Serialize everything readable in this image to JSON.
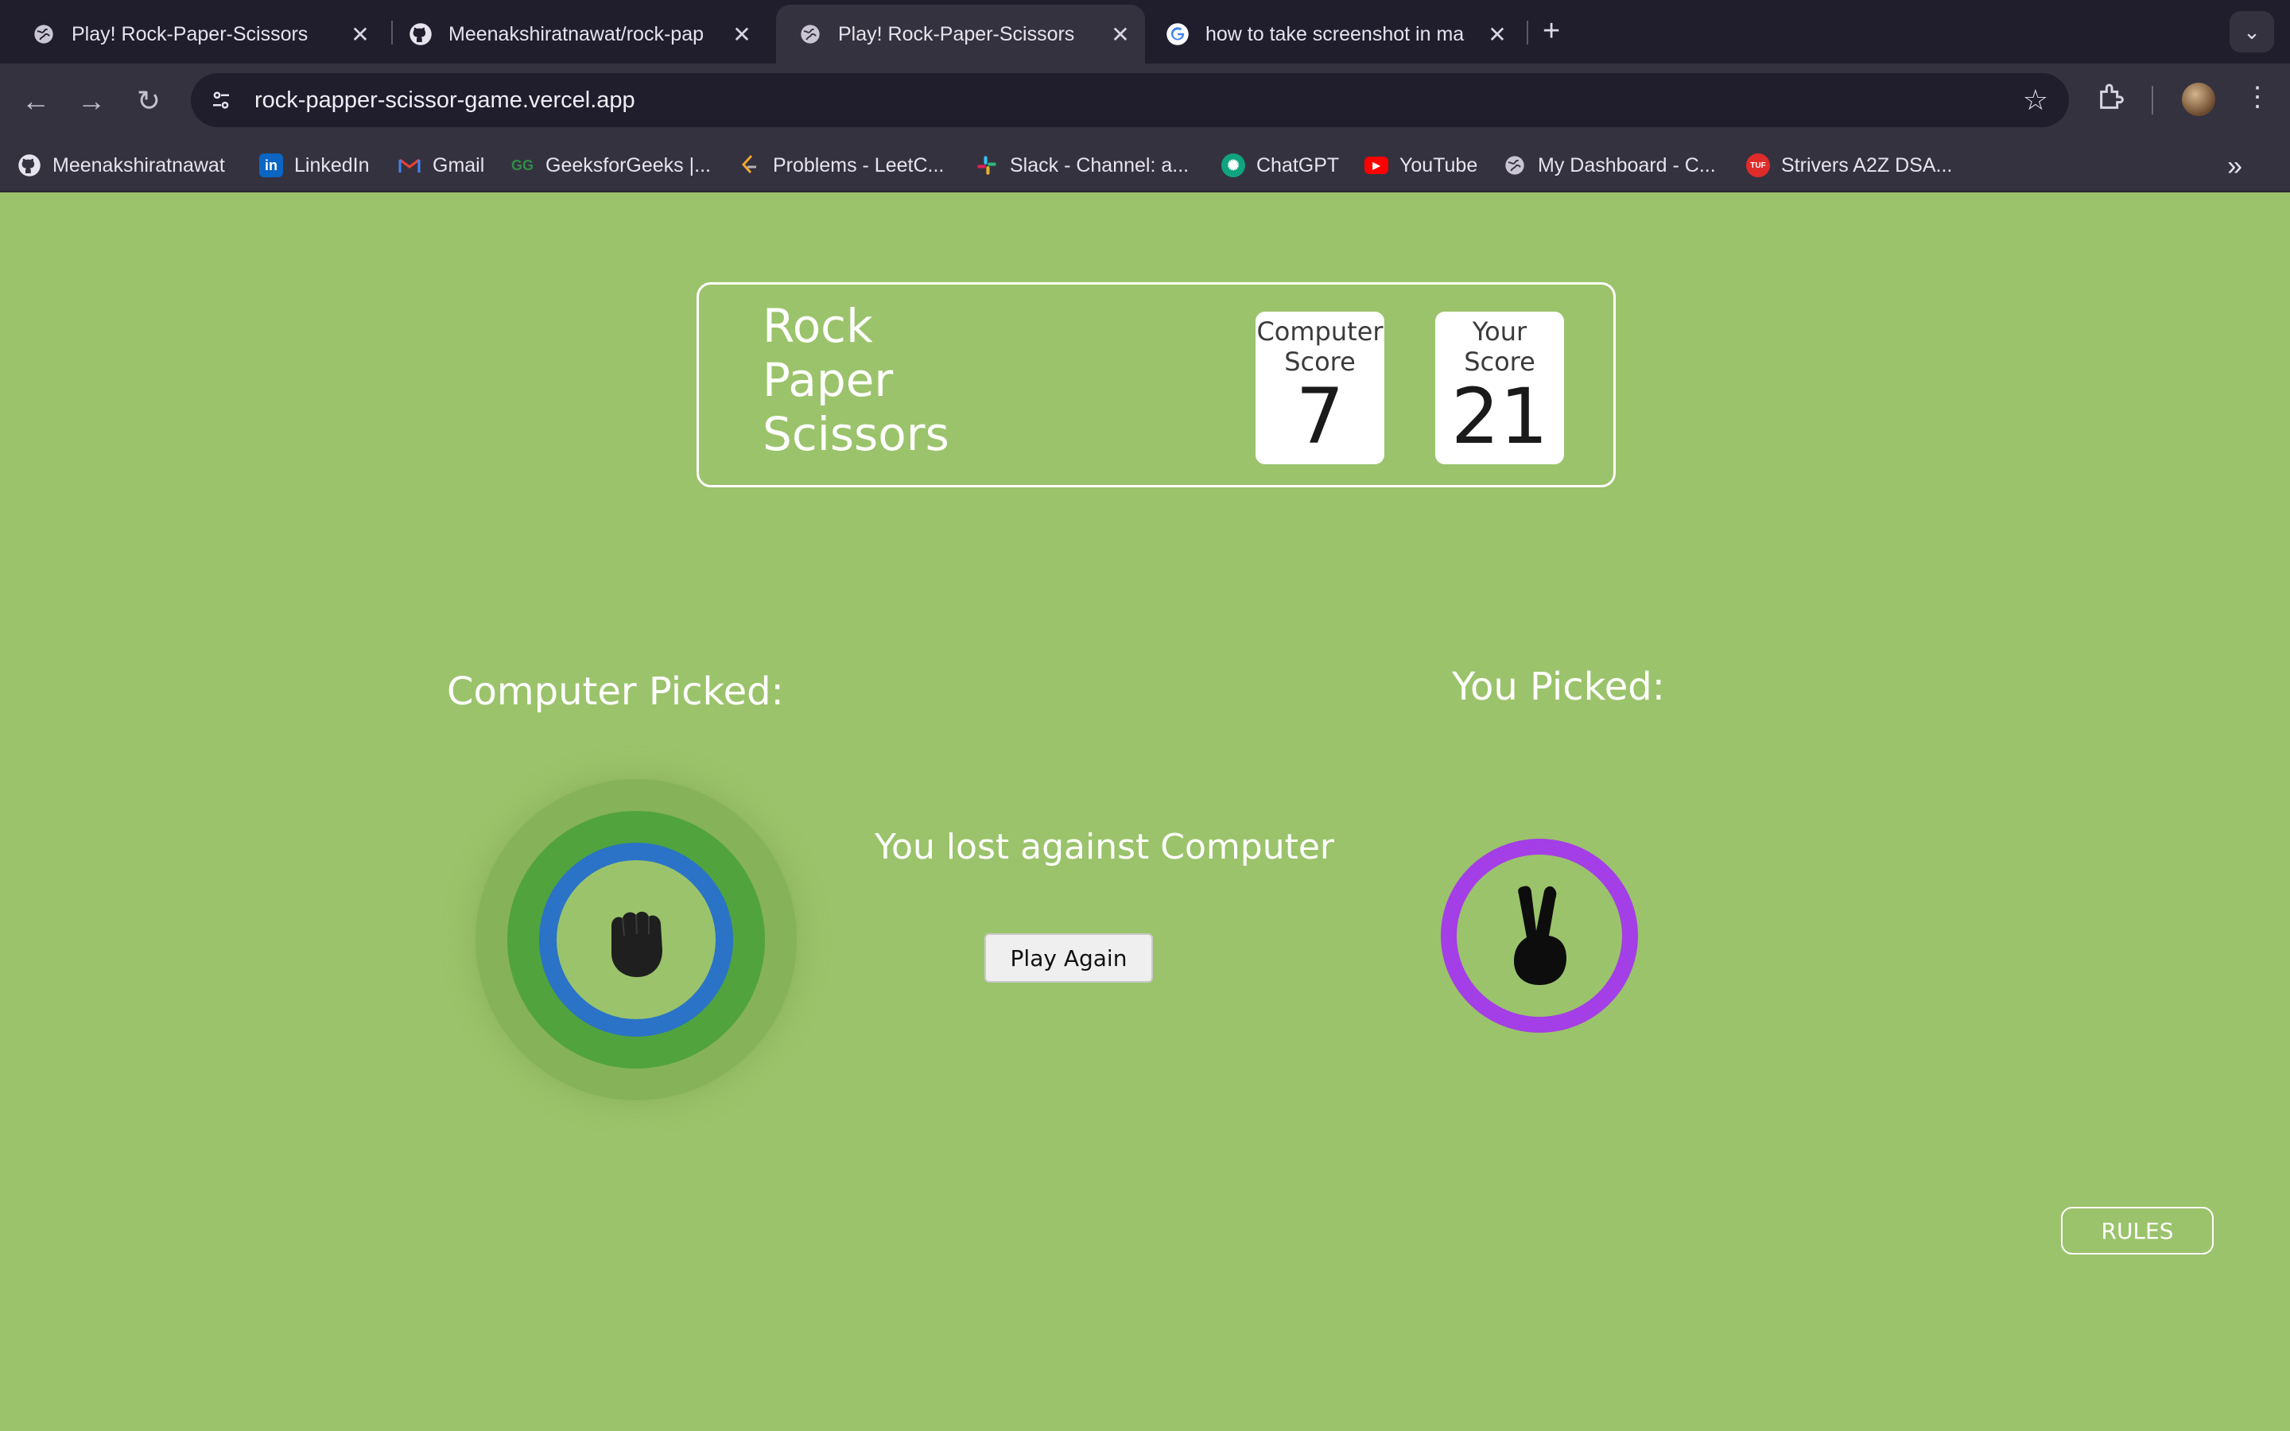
{
  "browser": {
    "tabs": [
      {
        "title": "Play! Rock-Paper-Scissors",
        "icon": "globe-icon"
      },
      {
        "title": "Meenakshiratnawat/rock-pap",
        "icon": "github-icon"
      },
      {
        "title": "Play! Rock-Paper-Scissors",
        "icon": "globe-icon",
        "active": true
      },
      {
        "title": "how to take screenshot in ma",
        "icon": "google-icon"
      }
    ],
    "close_glyph": "✕",
    "new_tab_glyph": "+",
    "url": "rock-papper-scissor-game.vercel.app",
    "bookmarks": [
      {
        "label": "Meenakshiratnawat",
        "icon": "github-icon"
      },
      {
        "label": "LinkedIn",
        "icon": "linkedin-icon"
      },
      {
        "label": "Gmail",
        "icon": "gmail-icon"
      },
      {
        "label": "GeeksforGeeks |...",
        "icon": "geeksforgeeks-icon"
      },
      {
        "label": "Problems - LeetC...",
        "icon": "leetcode-icon"
      },
      {
        "label": "Slack - Channel: a...",
        "icon": "slack-icon"
      },
      {
        "label": "ChatGPT",
        "icon": "chatgpt-icon"
      },
      {
        "label": "YouTube",
        "icon": "youtube-icon"
      },
      {
        "label": "My Dashboard - C...",
        "icon": "globe-icon"
      },
      {
        "label": "Strivers A2Z DSA...",
        "icon": "tuf-icon"
      }
    ]
  },
  "game": {
    "title_line1": "Rock",
    "title_line2": "Paper",
    "title_line3": "Scissors",
    "computer_score_label_1": "Computer",
    "computer_score_label_2": "Score",
    "computer_score": "7",
    "your_score_label_1": "Your",
    "your_score_label_2": "Score",
    "your_score": "21",
    "computer_picked_label": "Computer Picked:",
    "you_picked_label": "You Picked:",
    "computer_choice": "rock",
    "user_choice": "scissors",
    "result": "You lost against Computer",
    "play_again": "Play Again",
    "rules": "RULES"
  },
  "colors": {
    "background": "#9bc36b",
    "rock_ring": "#2a73c6",
    "scissors_ring": "#a43ee6",
    "winner_glow": "#51a33e"
  }
}
